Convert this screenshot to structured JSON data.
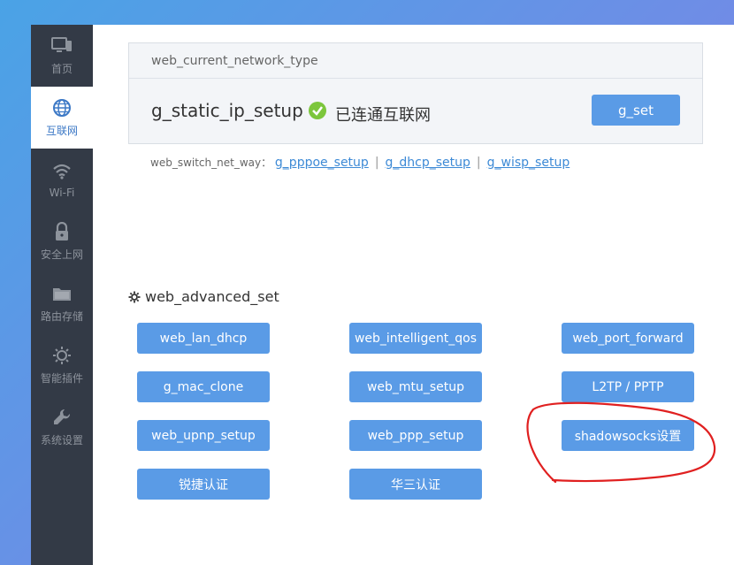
{
  "sidebar": {
    "items": [
      {
        "label": "首页",
        "icon": "monitor-icon"
      },
      {
        "label": "互联网",
        "icon": "globe-icon"
      },
      {
        "label": "Wi-Fi",
        "icon": "wifi-icon"
      },
      {
        "label": "安全上网",
        "icon": "lock-icon"
      },
      {
        "label": "路由存储",
        "icon": "folder-icon"
      },
      {
        "label": "智能插件",
        "icon": "sun-icon"
      },
      {
        "label": "系统设置",
        "icon": "wrench-icon"
      }
    ],
    "active_index": 1
  },
  "status": {
    "title": "web_current_network_type",
    "network_type": "g_static_ip_setup",
    "connection_status": "已连通互联网",
    "set_button": "g_set"
  },
  "switch": {
    "label": "web_switch_net_way：",
    "links": [
      "g_pppoe_setup",
      "g_dhcp_setup",
      "g_wisp_setup"
    ],
    "separator": "|"
  },
  "advanced": {
    "title": "web_advanced_set",
    "buttons": [
      "web_lan_dhcp",
      "web_intelligent_qos",
      "web_port_forward",
      "g_mac_clone",
      "web_mtu_setup",
      "L2TP / PPTP",
      "web_upnp_setup",
      "web_ppp_setup",
      "shadowsocks设置",
      "锐捷认证",
      "华三认证"
    ]
  },
  "colors": {
    "accent": "#5a9be6",
    "sidebar_bg": "#333a46",
    "success": "#7cc63c",
    "annotation": "#e02020"
  }
}
